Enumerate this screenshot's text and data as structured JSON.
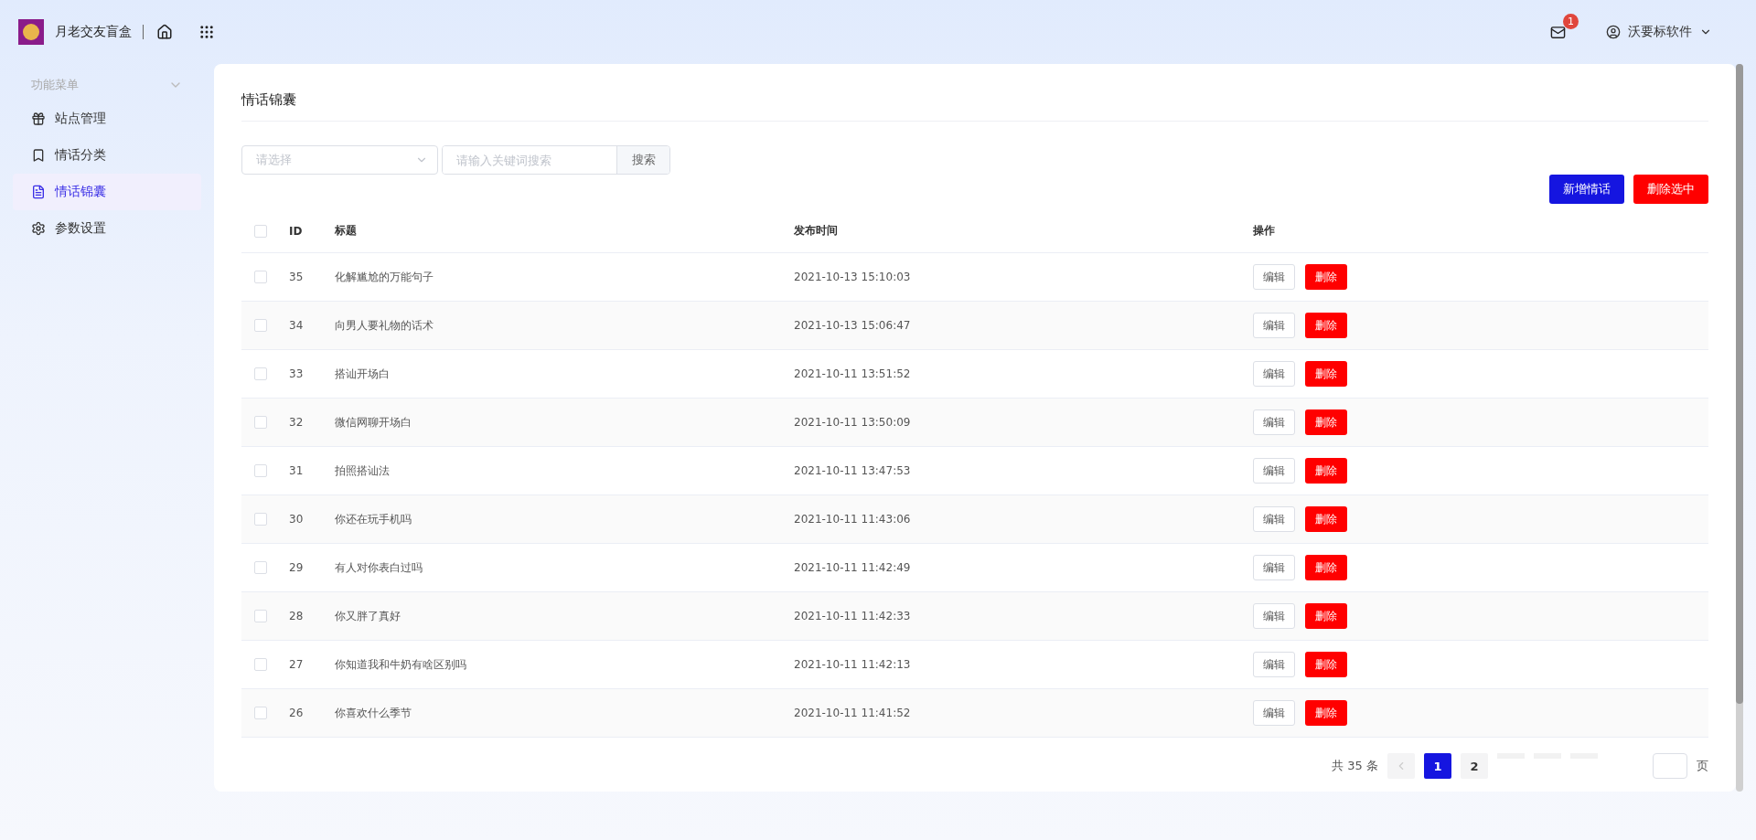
{
  "app": {
    "name": "月老交友盲盒"
  },
  "header": {
    "mail_badge": "1",
    "user": "沃要标软件"
  },
  "sidebar": {
    "heading": "功能菜单",
    "items": [
      {
        "label": "站点管理",
        "kind": "gift",
        "selected": false
      },
      {
        "label": "情话分类",
        "kind": "bookmark",
        "selected": false
      },
      {
        "label": "情话锦囊",
        "kind": "document",
        "selected": true
      },
      {
        "label": "参数设置",
        "kind": "gear",
        "selected": false
      }
    ]
  },
  "page": {
    "title": "情话锦囊",
    "filter": {
      "select_placeholder": "请选择",
      "search_placeholder": "请输入关键词搜索",
      "search_button": "搜索"
    },
    "actions": [
      {
        "label": "新增情话",
        "kind": "primary"
      },
      {
        "label": "删除选中",
        "kind": "danger"
      }
    ],
    "table": {
      "all_checked": false,
      "columns": [
        "ID",
        "标题",
        "发布时间",
        "操作"
      ],
      "rows": [
        {
          "checked": false,
          "id": "35",
          "title": "化解尴尬的万能句子",
          "time": "2021-10-13 15:10:03",
          "edit": "编辑",
          "delete": "删除"
        },
        {
          "checked": false,
          "id": "34",
          "title": "向男人要礼物的话术",
          "time": "2021-10-13 15:06:47",
          "edit": "编辑",
          "delete": "删除"
        },
        {
          "checked": false,
          "id": "33",
          "title": "搭讪开场白",
          "time": "2021-10-11 13:51:52",
          "edit": "编辑",
          "delete": "删除"
        },
        {
          "checked": false,
          "id": "32",
          "title": "微信网聊开场白",
          "time": "2021-10-11 13:50:09",
          "edit": "编辑",
          "delete": "删除"
        },
        {
          "checked": false,
          "id": "31",
          "title": "拍照搭讪法",
          "time": "2021-10-11 13:47:53",
          "edit": "编辑",
          "delete": "删除"
        },
        {
          "checked": false,
          "id": "30",
          "title": "你还在玩手机吗",
          "time": "2021-10-11 11:43:06",
          "edit": "编辑",
          "delete": "删除"
        },
        {
          "checked": false,
          "id": "29",
          "title": "有人对你表白过吗",
          "time": "2021-10-11 11:42:49",
          "edit": "编辑",
          "delete": "删除"
        },
        {
          "checked": false,
          "id": "28",
          "title": "你又胖了真好",
          "time": "2021-10-11 11:42:33",
          "edit": "编辑",
          "delete": "删除"
        },
        {
          "checked": false,
          "id": "27",
          "title": "你知道我和牛奶有啥区别吗",
          "time": "2021-10-11 11:42:13",
          "edit": "编辑",
          "delete": "删除"
        },
        {
          "checked": false,
          "id": "26",
          "title": "你喜欢什么季节",
          "time": "2021-10-11 11:41:52",
          "edit": "编辑",
          "delete": "删除"
        }
      ]
    },
    "pagination": {
      "total": "共 35 条",
      "pages": [
        {
          "label": "1",
          "selected": true
        },
        {
          "label": "2",
          "selected": false
        }
      ],
      "suffix": "页"
    }
  }
}
